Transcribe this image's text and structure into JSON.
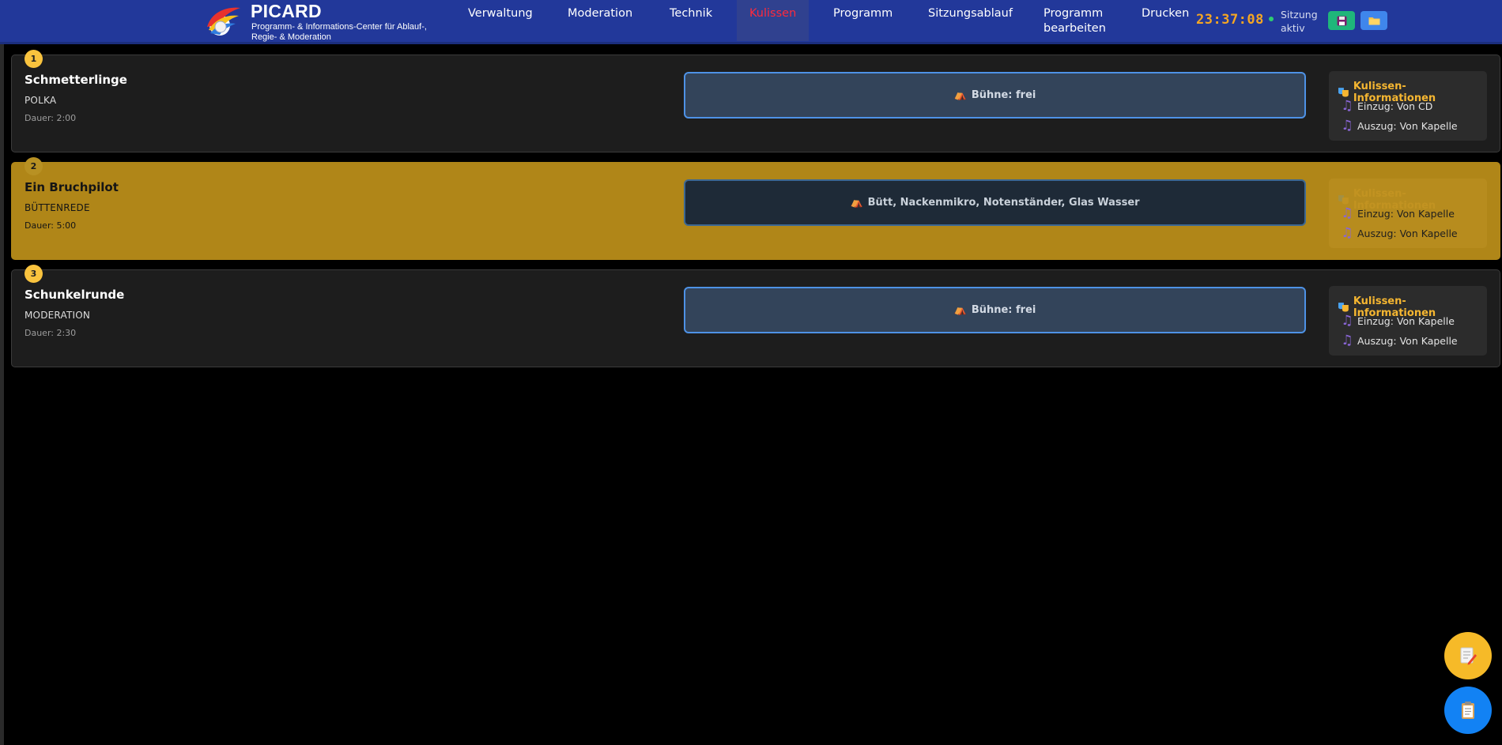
{
  "header": {
    "brand_title": "PICARD",
    "brand_subtitle": "Programm- & Informations-Center für Ablauf-, Regie- & Moderation",
    "nav": [
      {
        "label": "Verwaltung",
        "active": false
      },
      {
        "label": "Moderation",
        "active": false
      },
      {
        "label": "Technik",
        "active": false
      },
      {
        "label": "Kulissen",
        "active": true
      },
      {
        "label": "Programm",
        "active": false
      },
      {
        "label": "Sitzungsablauf",
        "active": false
      },
      {
        "label": "Programm bearbeiten",
        "active": false
      },
      {
        "label": "Drucken",
        "active": false
      }
    ],
    "clock": "23:37:08",
    "session_status": "Sitzung aktiv",
    "save_icon": "floppy-disk-icon",
    "open_icon": "folder-icon"
  },
  "program": [
    {
      "number": "1",
      "title": "Schmetterlinge",
      "type": "POLKA",
      "duration": "Dauer: 2:00",
      "stage": "Bühne: frei",
      "current": false,
      "info_heading": "Kulissen-Informationen",
      "entry": "Einzug: Von CD",
      "exit": "Auszug: Von Kapelle"
    },
    {
      "number": "2",
      "title": "Ein Bruchpilot",
      "type": "BÜTTENREDE",
      "duration": "Dauer: 5:00",
      "stage": "Bütt, Nackenmikro, Notenständer, Glas Wasser",
      "current": true,
      "info_heading": "Kulissen-Informationen",
      "entry": "Einzug: Von Kapelle",
      "exit": "Auszug: Von Kapelle"
    },
    {
      "number": "3",
      "title": "Schunkelrunde",
      "type": "MODERATION",
      "duration": "Dauer: 2:30",
      "stage": "Bühne: frei",
      "current": false,
      "info_heading": "Kulissen-Informationen",
      "entry": "Einzug: Von Kapelle",
      "exit": "Auszug: Von Kapelle"
    }
  ],
  "icons": {
    "stage": "circus-tent-icon",
    "info": "theater-masks-icon",
    "music": "music-note-icon"
  },
  "fabs": {
    "notes": "notepad-pencil-icon",
    "board": "clipboard-icon"
  },
  "colors": {
    "header_bg": "#22389a",
    "active_nav": "#ff2a3c",
    "clock": "#f5a623",
    "current_row": "#b08618",
    "stage_border": "#4e92e6",
    "info_heading": "#f5b631"
  }
}
